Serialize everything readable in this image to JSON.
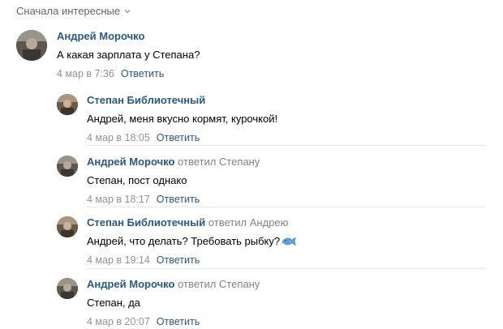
{
  "sort": {
    "label": "Сначала интересные"
  },
  "comments": [
    {
      "author": "Андрей Морочко",
      "replied": "",
      "text": "А какая зарплата у Степана?",
      "date": "4 мар в 7:36",
      "reply": "Ответить"
    },
    {
      "author": "Степан Библиотечный",
      "replied": "",
      "text": "Андрей, меня вкусно кормят, курочкой!",
      "date": "4 мар в 18:05",
      "reply": "Ответить"
    },
    {
      "author": "Андрей Морочко",
      "replied": "ответил Степану",
      "text": "Степан, пост однако",
      "date": "4 мар в 18:17",
      "reply": "Ответить"
    },
    {
      "author": "Степан Библиотечный",
      "replied": "ответил Андрею",
      "text": "Андрей, что делать? Требовать рыбку?",
      "date": "4 мар в 19:14",
      "reply": "Ответить"
    },
    {
      "author": "Андрей Морочко",
      "replied": "ответил Степану",
      "text": "Степан, да",
      "date": "4 мар в 20:07",
      "reply": "Ответить"
    }
  ],
  "colors": {
    "link": "#2a5885",
    "muted": "#939393",
    "divider": "#e7e8ec"
  }
}
